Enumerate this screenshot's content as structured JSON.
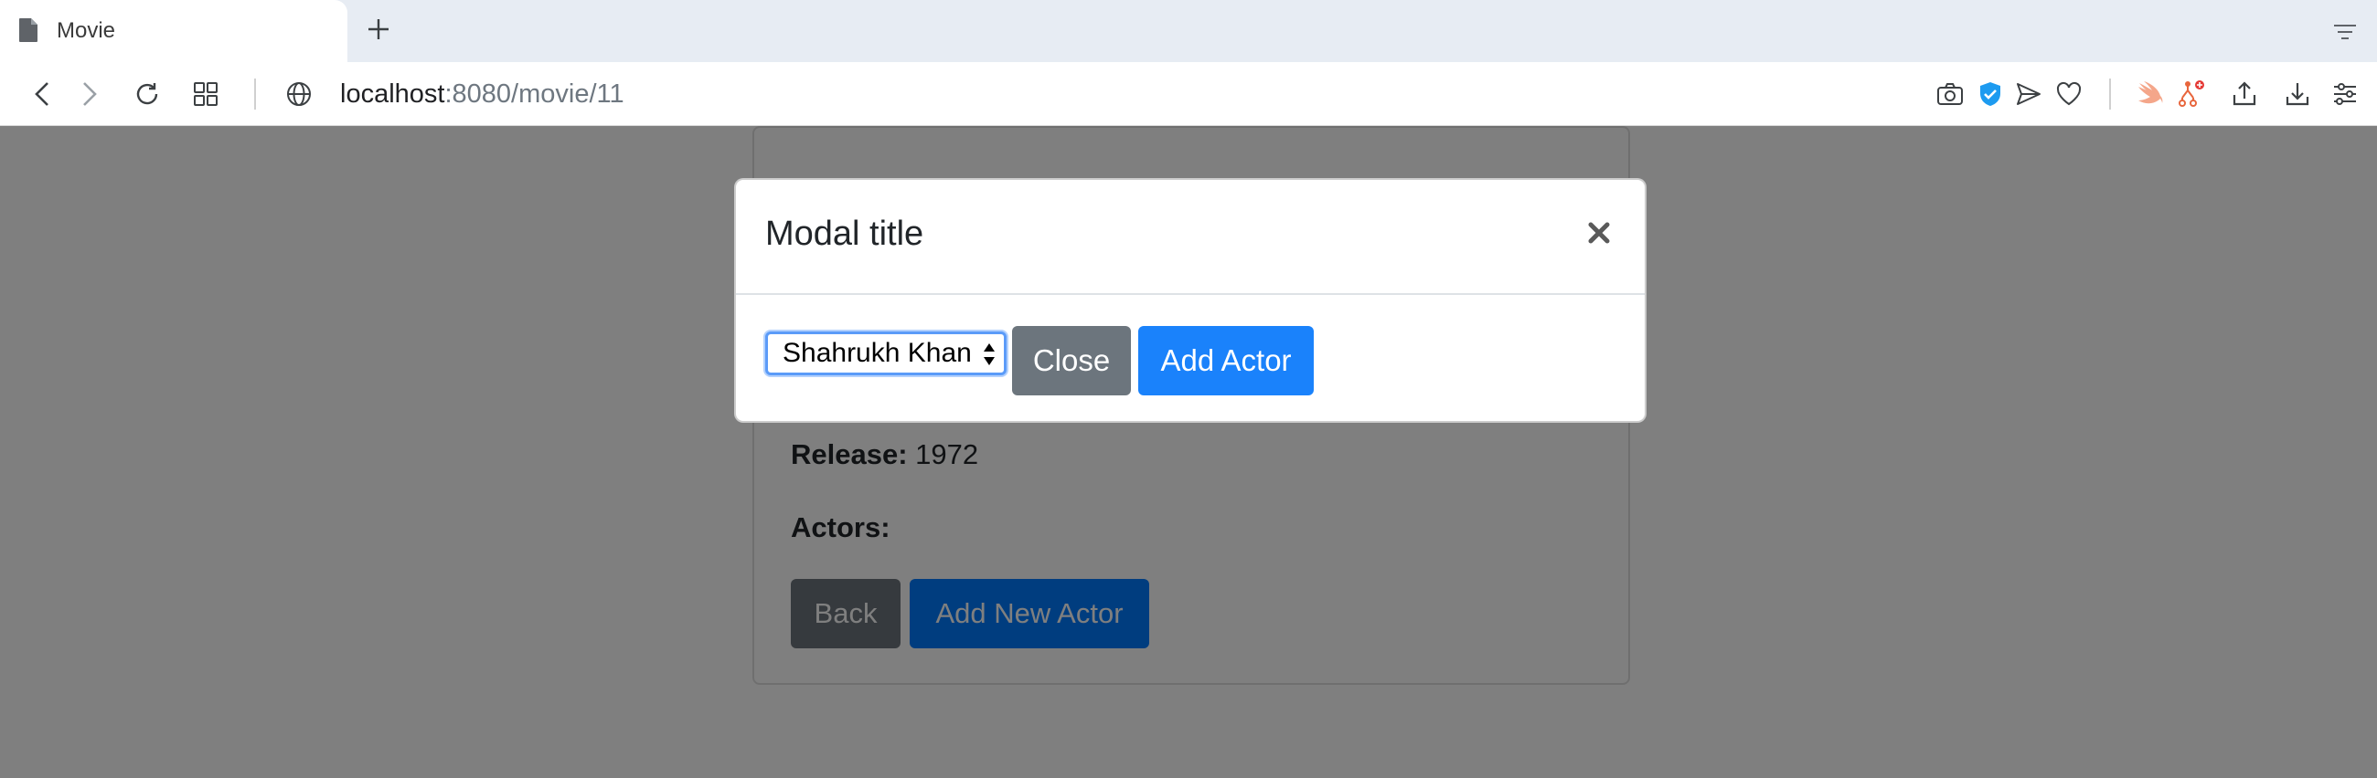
{
  "browser": {
    "tab_title": "Movie",
    "url_host": "localhost",
    "url_path": ":8080/movie/11"
  },
  "movie": {
    "release_label": "Release:",
    "release_value": "1972",
    "actors_label": "Actors:",
    "back_label": "Back",
    "add_new_actor_label": "Add New Actor"
  },
  "modal": {
    "title": "Modal title",
    "close_symbol": "×",
    "selected_actor": "Shahrukh Khan",
    "close_label": "Close",
    "add_actor_label": "Add Actor"
  },
  "colors": {
    "primary": "#007bff",
    "secondary": "#6c757d",
    "backdrop": "rgba(0,0,0,0.5)"
  }
}
